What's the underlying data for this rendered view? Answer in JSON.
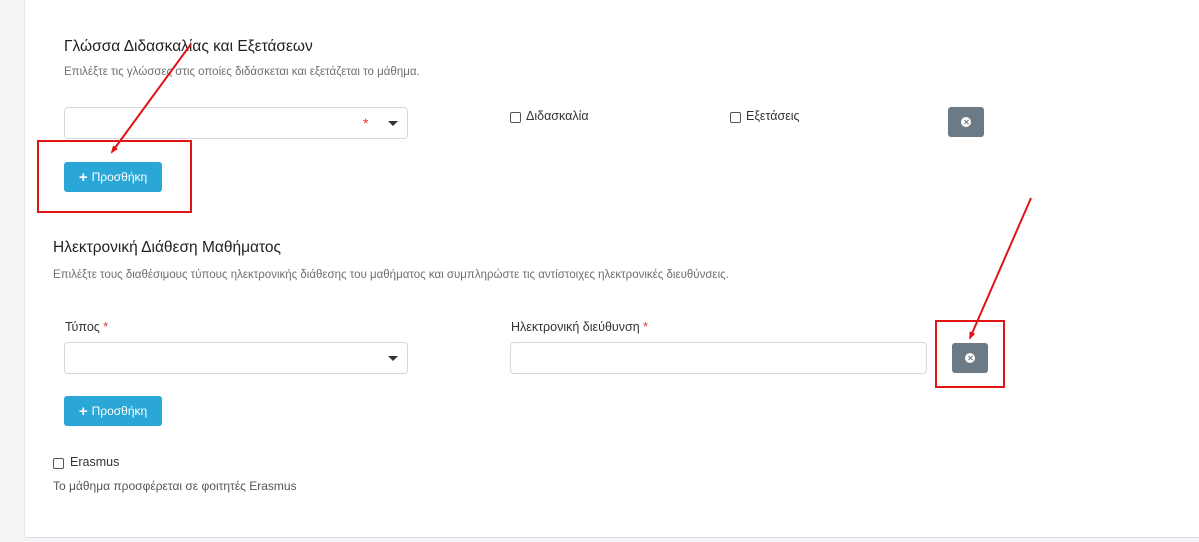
{
  "language_section": {
    "title": "Γλώσσα Διδασκαλίας και Εξετάσεων",
    "description": "Επιλέξτε τις γλώσσες στις οποίες διδάσκεται και εξετάζεται το μάθημα.",
    "language_select_value": "",
    "required_mark": "*",
    "teaching_checkbox_label": "Διδασκαλία",
    "exams_checkbox_label": "Εξετάσεις",
    "add_button_label": "Προσθήκη"
  },
  "online_section": {
    "title": "Ηλεκτρονική Διάθεση Μαθήματος",
    "description": "Επιλέξτε τους διαθέσιμους τύπους ηλεκτρονικής διάθεσης του μαθήματος και συμπληρώστε τις αντίστοιχες ηλεκτρονικές διευθύνσεις.",
    "type_label": "Τύπος",
    "address_label": "Ηλεκτρονική διεύθυνση",
    "required_mark": "*",
    "type_select_value": "",
    "address_value": "",
    "add_button_label": "Προσθήκη"
  },
  "erasmus": {
    "checkbox_label": "Erasmus",
    "help_text": "Το μάθημα προσφέρεται σε φοιτητές Erasmus"
  },
  "annotation_color": "#e01414",
  "accent_color": "#2aa7d6"
}
